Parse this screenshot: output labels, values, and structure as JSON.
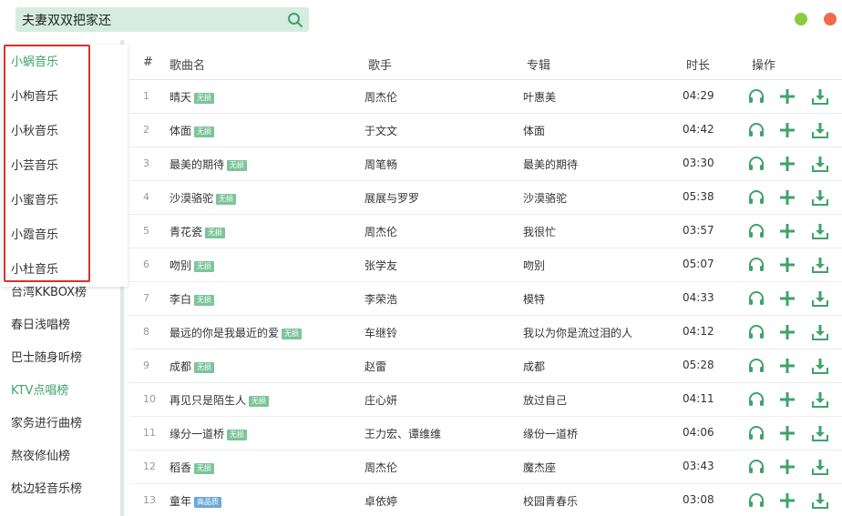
{
  "search": {
    "value": "夫妻双双把家还"
  },
  "colors": {
    "accent": "#3fa36a",
    "window_green": "#8ccb3f",
    "window_red": "#ef6a4a",
    "highlight": "#d9322a"
  },
  "dropdown": [
    {
      "label": "小蜗音乐",
      "active": true
    },
    {
      "label": "小枸音乐",
      "active": false
    },
    {
      "label": "小秋音乐",
      "active": false
    },
    {
      "label": "小芸音乐",
      "active": false
    },
    {
      "label": "小蜜音乐",
      "active": false
    },
    {
      "label": "小霞音乐",
      "active": false
    },
    {
      "label": "小杜音乐",
      "active": false
    }
  ],
  "sidebar": [
    {
      "label": "台湾KKBOX榜",
      "active": false
    },
    {
      "label": "春日浅唱榜",
      "active": false
    },
    {
      "label": "巴士随身听榜",
      "active": false
    },
    {
      "label": "KTV点唱榜",
      "active": true
    },
    {
      "label": "家务进行曲榜",
      "active": false
    },
    {
      "label": "熬夜修仙榜",
      "active": false
    },
    {
      "label": "枕边轻音乐榜",
      "active": false
    }
  ],
  "table": {
    "headers": {
      "index": "#",
      "song": "歌曲名",
      "artist": "歌手",
      "album": "专辑",
      "duration": "时长",
      "actions": "操作"
    },
    "rows": [
      {
        "index": "1",
        "song": "晴天",
        "badge": "无损",
        "badge_type": "lossless",
        "artist": "周杰伦",
        "album": "叶惠美",
        "duration": "04:29"
      },
      {
        "index": "2",
        "song": "体面",
        "badge": "无损",
        "badge_type": "lossless",
        "artist": "于文文",
        "album": "体面",
        "duration": "04:42"
      },
      {
        "index": "3",
        "song": "最美的期待",
        "badge": "无损",
        "badge_type": "lossless",
        "artist": "周笔畅",
        "album": "最美的期待",
        "duration": "03:30"
      },
      {
        "index": "4",
        "song": "沙漠骆驼",
        "badge": "无损",
        "badge_type": "lossless",
        "artist": "展展与罗罗",
        "album": "沙漠骆驼",
        "duration": "05:38"
      },
      {
        "index": "5",
        "song": "青花瓷",
        "badge": "无损",
        "badge_type": "lossless",
        "artist": "周杰伦",
        "album": "我很忙",
        "duration": "03:57"
      },
      {
        "index": "6",
        "song": "吻别",
        "badge": "无损",
        "badge_type": "lossless",
        "artist": "张学友",
        "album": "吻别",
        "duration": "05:07"
      },
      {
        "index": "7",
        "song": "李白",
        "badge": "无损",
        "badge_type": "lossless",
        "artist": "李荣浩",
        "album": "模特",
        "duration": "04:33"
      },
      {
        "index": "8",
        "song": "最远的你是我最近的爱",
        "badge": "无损",
        "badge_type": "lossless",
        "artist": "车继铃",
        "album": "我以为你是流过泪的人",
        "duration": "04:12"
      },
      {
        "index": "9",
        "song": "成都",
        "badge": "无损",
        "badge_type": "lossless",
        "artist": "赵雷",
        "album": "成都",
        "duration": "05:28"
      },
      {
        "index": "10",
        "song": "再见只是陌生人",
        "badge": "无损",
        "badge_type": "lossless",
        "artist": "庄心妍",
        "album": "放过自己",
        "duration": "04:11"
      },
      {
        "index": "11",
        "song": "缘分一道桥",
        "badge": "无损",
        "badge_type": "lossless",
        "artist": "王力宏、谭维维",
        "album": "缘份一道桥",
        "duration": "04:06"
      },
      {
        "index": "12",
        "song": "稻香",
        "badge": "无损",
        "badge_type": "lossless",
        "artist": "周杰伦",
        "album": "魔杰座",
        "duration": "03:43"
      },
      {
        "index": "13",
        "song": "童年",
        "badge": "高品质",
        "badge_type": "hq",
        "artist": "卓依婷",
        "album": "校园青春乐",
        "duration": "03:08"
      }
    ]
  }
}
